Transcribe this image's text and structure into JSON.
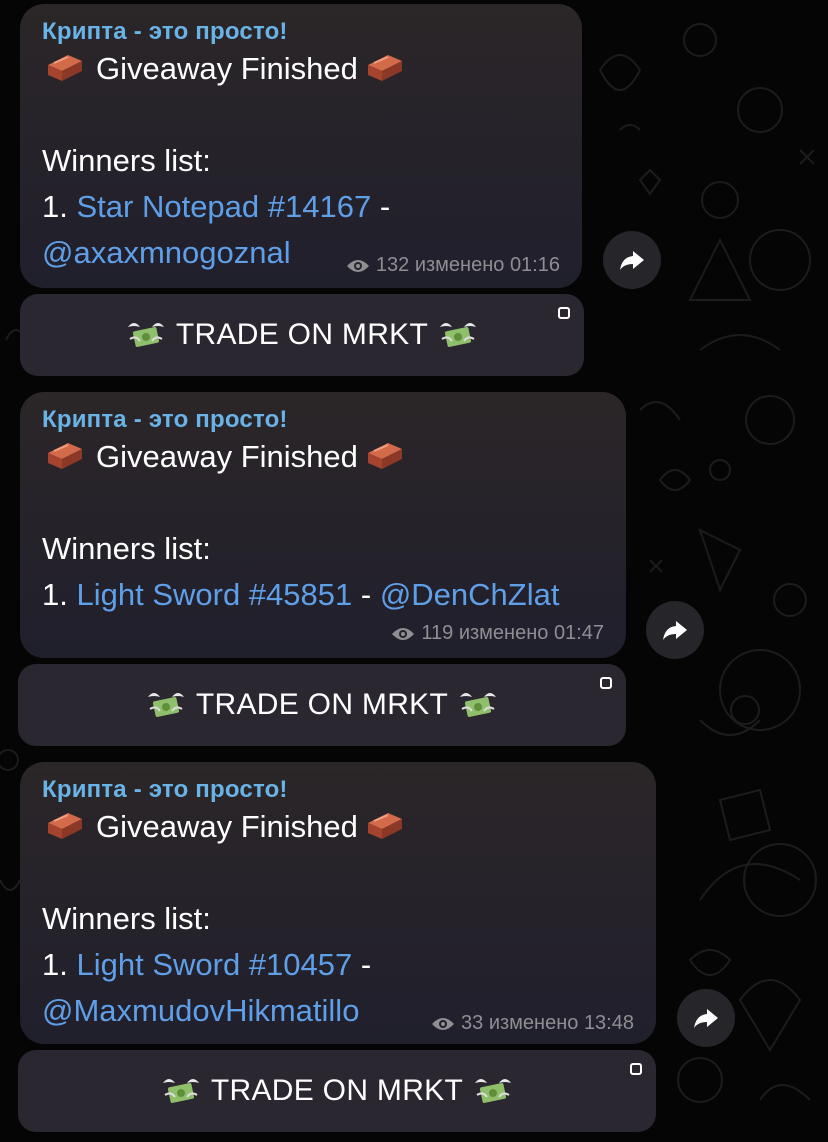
{
  "messages": [
    {
      "channel": "Крипта - это просто!",
      "title": "Giveaway Finished",
      "winners_label": "Winners list:",
      "winner_number": "1.",
      "prize": "Star Notepad #14167",
      "separator": "-",
      "username": "@axaxmnogoznal",
      "views": "132",
      "edited_label": "изменено",
      "time": "01:16",
      "button_label": "TRADE ON MRKT"
    },
    {
      "channel": "Крипта - это просто!",
      "title": "Giveaway Finished",
      "winners_label": "Winners list:",
      "winner_number": "1.",
      "prize": "Light Sword #45851",
      "separator": "-",
      "username": "@DenChZlat",
      "views": "119",
      "edited_label": "изменено",
      "time": "01:47",
      "button_label": "TRADE ON MRKT"
    },
    {
      "channel": "Крипта - это просто!",
      "title": "Giveaway Finished",
      "winners_label": "Winners list:",
      "winner_number": "1.",
      "prize": "Light Sword #10457",
      "separator": "-",
      "username": "@MaxmudovHikmatillo",
      "views": "33",
      "edited_label": "изменено",
      "time": "13:48",
      "button_label": "TRADE ON MRKT"
    }
  ],
  "icons": {
    "title_decoration": "brick-emoji-icon",
    "button_decoration": "money-with-wings-icon",
    "views": "eye-icon",
    "share": "share-arrow-icon",
    "button_link": "external-link-icon"
  },
  "colors": {
    "background": "#050505",
    "bubble": "#2b2628",
    "channel_name": "#6ab3e6",
    "link": "#5f9fe8",
    "meta": "#8e8e93",
    "button": "#2a2731"
  }
}
